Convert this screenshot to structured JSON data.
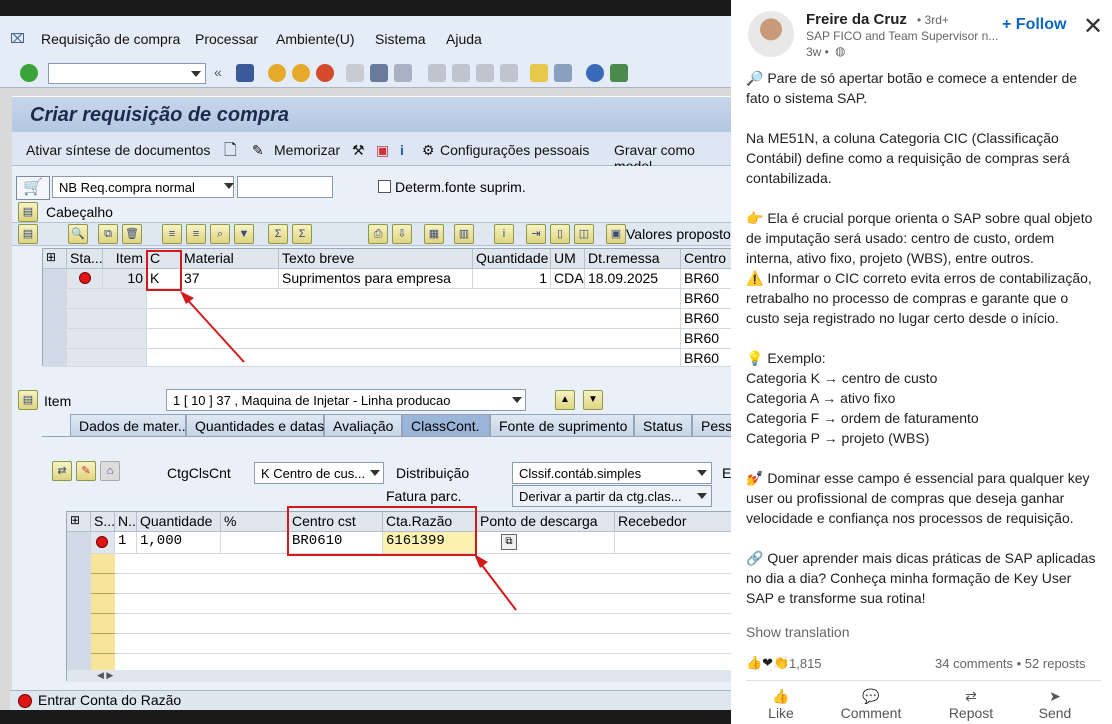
{
  "menu": [
    "Requisição de compra",
    "Processar",
    "Ambiente(U)",
    "Sistema",
    "Ajuda"
  ],
  "page_title": "Criar requisição de compra",
  "app_toolbar": {
    "summary": "Ativar síntese de documentos",
    "hold": "Memorizar",
    "personal": "Configurações pessoais",
    "save_as": "Gravar como model"
  },
  "header_row": {
    "doc_type": "NB Req.compra normal",
    "source_label": "Determ.fonte suprim.",
    "header_label": "Cabeçalho",
    "proposal": "Valores proposto"
  },
  "items_grid": {
    "headers": [
      "Sta...",
      "Item",
      "C",
      "Material",
      "Texto breve",
      "Quantidade",
      "UM",
      "Dt.remessa",
      "Centro"
    ],
    "row": {
      "item": "10",
      "cat": "K",
      "material": "37",
      "text": "Suprimentos para empresa",
      "qty": "1",
      "um": "CDA",
      "date": "18.09.2025",
      "plant": "BR60"
    },
    "plants": [
      "BR60",
      "BR60",
      "BR60",
      "BR60"
    ]
  },
  "item_section": {
    "label": "Item",
    "selector": "1 [ 10 ] 37 , Maquina de Injetar - Linha producao"
  },
  "tabs": [
    "Dados de mater...",
    "Quantidades e datas",
    "Avaliação",
    "ClassCont.",
    "Fonte de suprimento",
    "Status",
    "Pesso"
  ],
  "acct": {
    "ctg_label": "CtgClsCnt",
    "ctg_value": "K Centro de cus...",
    "dist_label": "Distribuição",
    "dist_value": "Clssif.contáb.simples",
    "partial_label": "Fatura parc.",
    "partial_value": "Derivar a partir da ctg.clas...",
    "extra": "E",
    "headers": [
      "S...",
      "N...",
      "Quantidade",
      "%",
      "Centro cst",
      "Cta.Razão",
      "Ponto de descarga",
      "Recebedor"
    ],
    "row": {
      "n": "1",
      "qty": "1,000",
      "cc": "BR0610",
      "gl": "6161399"
    }
  },
  "status_msg": "Entrar Conta do Razão",
  "post": {
    "author": "Freire da Cruz",
    "degree": "• 3rd+",
    "headline": "SAP FICO and Team Supervisor n...",
    "time": "3w •",
    "follow": "+ Follow",
    "p1": "🔎 Pare de só apertar botão e comece a entender de fato o sistema SAP.",
    "p2": " Na ME51N, a coluna Categoria CIC (Classificação Contábil) define como a requisição de compras será contabilizada.",
    "p3": "👉 Ela é crucial porque orienta o SAP sobre qual objeto de imputação será usado: centro de custo, ordem interna, ativo fixo, projeto (WBS), entre outros.",
    "p4": "⚠️ Informar o CIC correto evita erros de contabilização, retrabalho no processo de compras e garante que o custo seja registrado no lugar certo desde o início.",
    "p5": "💡 Exemplo:",
    "ex": [
      "Categoria K → centro de custo",
      "Categoria A → ativo fixo",
      "Categoria F → ordem de faturamento",
      "Categoria P → projeto (WBS)"
    ],
    "p6": "💅 Dominar esse campo é essencial para qualquer key user ou profissional de compras que deseja ganhar velocidade e confiança nos processos de requisição.",
    "p7": "🔗 Quer aprender mais dicas práticas de SAP aplicadas no dia a dia? Conheça minha formação de Key User SAP e transforme sua rotina!",
    "translate": "Show translation",
    "reactions": "1,815",
    "comments": "34 comments • 52 reposts",
    "actions": [
      "Like",
      "Comment",
      "Repost",
      "Send"
    ]
  },
  "colors": {
    "accent": "#0a66c2",
    "red": "#d21a1a",
    "sap_title": "#b4c7e2"
  }
}
